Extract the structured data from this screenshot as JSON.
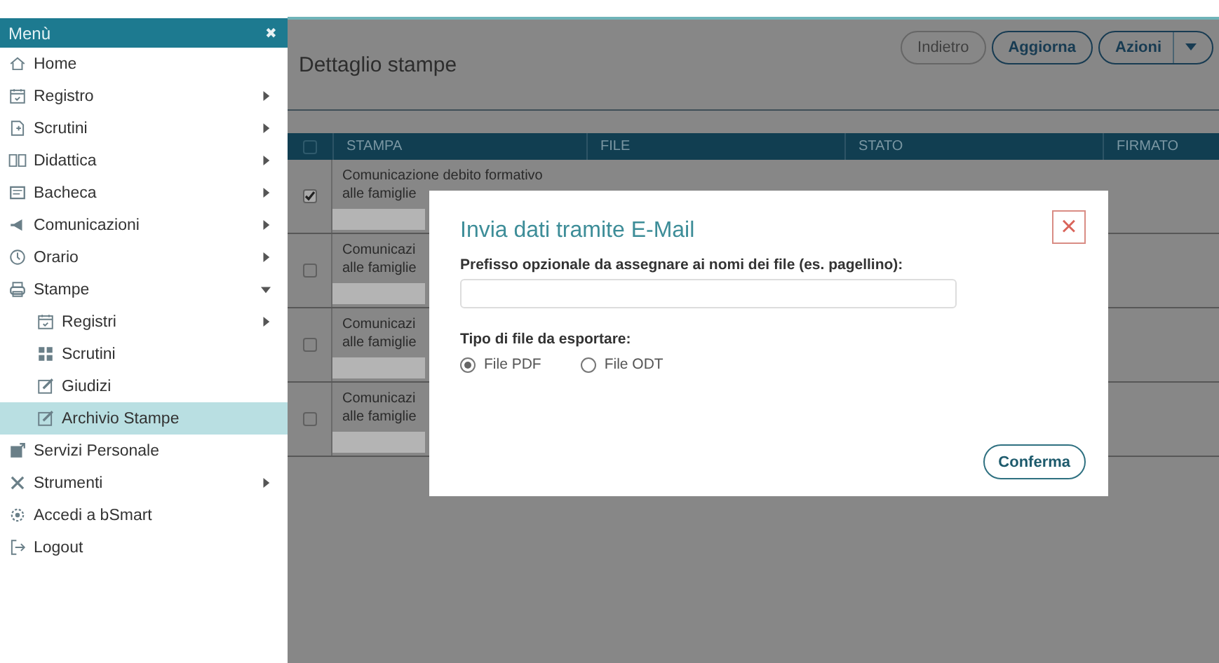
{
  "sidebar": {
    "title": "Menù",
    "close": "✖",
    "items": [
      {
        "label": "Home",
        "selected": false
      },
      {
        "label": "Registro",
        "expanded": false,
        "selected": false
      },
      {
        "label": "Scrutini",
        "expanded": false,
        "selected": false
      },
      {
        "label": "Didattica",
        "expanded": false,
        "selected": false
      },
      {
        "label": "Bacheca",
        "expanded": false,
        "selected": false
      },
      {
        "label": "Comunicazioni",
        "expanded": false,
        "selected": false
      },
      {
        "label": "Orario",
        "expanded": false,
        "selected": false
      },
      {
        "label": "Stampe",
        "expanded": true,
        "selected": false,
        "children": [
          {
            "label": "Registri",
            "expanded": false,
            "selected": false
          },
          {
            "label": "Scrutini",
            "selected": false
          },
          {
            "label": "Giudizi",
            "selected": false
          },
          {
            "label": "Archivio Stampe",
            "selected": true
          }
        ]
      },
      {
        "label": "Servizi Personale",
        "selected": false
      },
      {
        "label": "Strumenti",
        "expanded": false,
        "selected": false
      },
      {
        "label": "Accedi a bSmart",
        "selected": false
      },
      {
        "label": "Logout",
        "selected": false
      }
    ]
  },
  "page": {
    "title": "Dettaglio stampe",
    "buttons": [
      {
        "label": "Indietro",
        "disabled": true,
        "dropdown": false
      },
      {
        "label": "Aggiorna",
        "disabled": false,
        "dropdown": false
      },
      {
        "label": "Azioni",
        "disabled": false,
        "dropdown": true
      }
    ]
  },
  "table": {
    "header_checked": false,
    "columns": [
      "STAMPA",
      "FILE",
      "STATO",
      "FIRMATO"
    ],
    "rows": [
      {
        "checked": true,
        "stampa": [
          "Comunicazione debito formativo",
          "alle famiglie"
        ]
      },
      {
        "checked": false,
        "stampa": [
          "Comunicazi",
          "alle famiglie"
        ]
      },
      {
        "checked": false,
        "stampa": [
          "Comunicazi",
          "alle famiglie"
        ]
      },
      {
        "checked": false,
        "stampa": [
          "Comunicazi",
          "alle famiglie"
        ]
      }
    ]
  },
  "dialog": {
    "title": "Invia dati tramite E-Mail",
    "close": "×",
    "prefix_label": "Prefisso opzionale da assegnare ai nomi dei file (es. pagellino):",
    "type_label": "Tipo di file da esportare:",
    "options": [
      {
        "label": "File PDF",
        "selected": true
      },
      {
        "label": "File ODT",
        "selected": false
      }
    ],
    "confirm": "Conferma"
  }
}
